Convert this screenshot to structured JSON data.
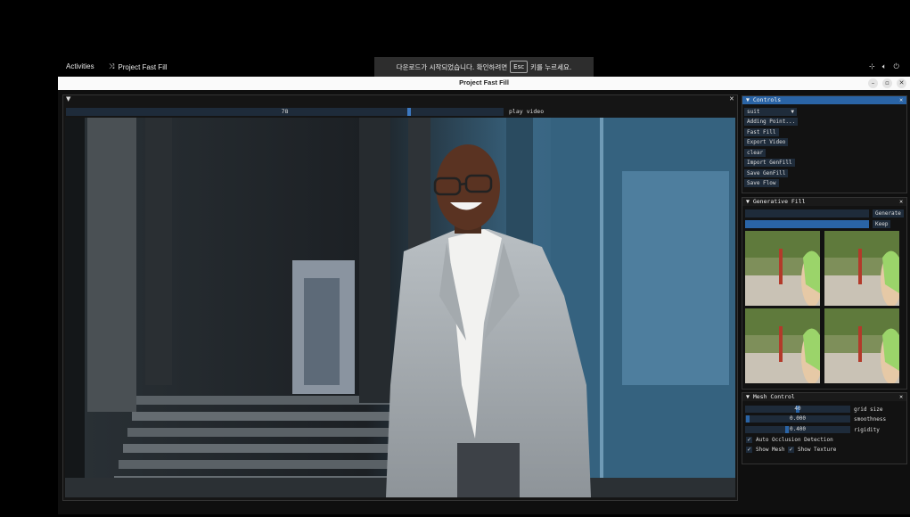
{
  "topbar": {
    "activities": "Activities",
    "app_name": "Project Fast Fill"
  },
  "notification": {
    "text_before": "다운로드가 시작되었습니다. 확인하려면",
    "key": "Esc",
    "text_after": "키를 누르세요."
  },
  "window": {
    "title": "Project Fast Fill"
  },
  "main_panel": {
    "frame_value": "78",
    "frame_fraction": 0.78,
    "play_label": "play video"
  },
  "controls": {
    "title": "Controls",
    "dropdown_value": "suit",
    "buttons": [
      "Adding Point...",
      "Fast Fill",
      "Export Video",
      "clear",
      "Import GenFill",
      "Save GenFill",
      "Save Flow"
    ]
  },
  "generative_fill": {
    "title": "Generative Fill",
    "generate_label": "Generate",
    "keep_label": "Keep"
  },
  "mesh_control": {
    "title": "Mesh Control",
    "grid_size_value": "40",
    "grid_size_label": "grid size",
    "smoothness_value": "0.000",
    "smoothness_label": "smoothness",
    "rigidity_value": "0.400",
    "rigidity_label": "rigidity",
    "auto_occlusion_label": "Auto Occlusion Detection",
    "show_mesh_label": "Show Mesh",
    "show_texture_label": "Show Texture"
  },
  "colors": {
    "accent": "#2a64a6",
    "slider_bg": "#1e2b3a"
  }
}
